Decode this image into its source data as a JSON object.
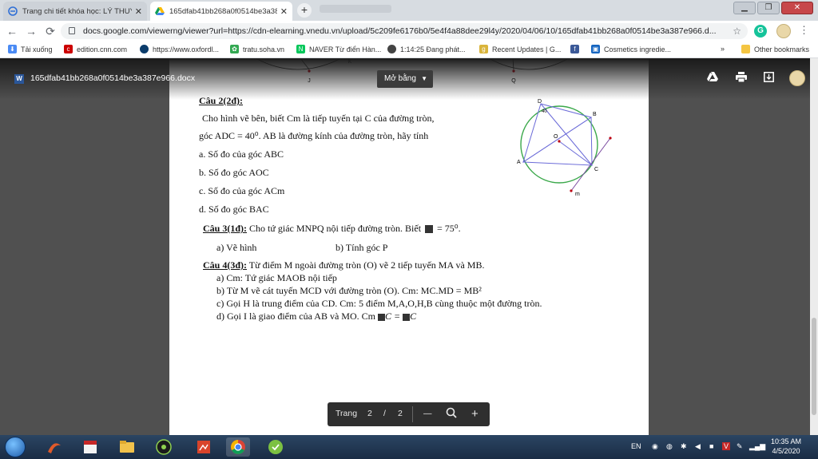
{
  "browser": {
    "tabs": [
      {
        "title": "Trang chi tiết khóa học: LÝ THUY",
        "active": false
      },
      {
        "title": "165dfab41bb268a0f0514be3a38",
        "active": true
      }
    ],
    "new_tab_label": "+",
    "url": "docs.google.com/viewerng/viewer?url=https://cdn-elearning.vnedu.vn/upload/5c209fe6176b0/5e4f4a88dee29l4y/2020/04/06/10/165dfab41bb268a0f0514be3a387e966.d...",
    "bookmarks": [
      {
        "label": "Tải xuống"
      },
      {
        "label": "edition.cnn.com"
      },
      {
        "label": "https://www.oxfordl..."
      },
      {
        "label": "tratu.soha.vn"
      },
      {
        "label": "NAVER Từ điển Hàn..."
      },
      {
        "label": "1:14:25 Đang phát..."
      },
      {
        "label": "Recent Updates | G..."
      },
      {
        "label": "Cosmetics ingredie..."
      }
    ],
    "bookmarks_more": "»",
    "other_bookmarks": "Other bookmarks"
  },
  "viewer": {
    "file_name": "165dfab41bb268a0f0514be3a387e966.docx",
    "open_with_label": "Mở bằng",
    "page_label": "Trang",
    "current_page": "2",
    "page_sep": "/",
    "total_pages": "2",
    "zoom_out": "—",
    "zoom_in": "+"
  },
  "document": {
    "top_labels": {
      "j": "J",
      "q": "Q",
      "k": "K"
    },
    "q2_title": "Câu 2(2đ):",
    "q2_line1": "Cho hình vẽ bên, biết Cm là tiếp tuyến   tại C của đường tròn,",
    "q2_line2": "góc ADC  = 40⁰.  AB là đường kính của đường tròn, hãy tính",
    "q2_a": "a. Số đo của góc ABC",
    "q2_b": "b. Số đo góc AOC",
    "q2_c": "c. Số đo của góc ACm",
    "q2_d": "d. Số đo góc BAC",
    "q3_title": "Câu 3(1đ):",
    "q3_text": " Cho tứ giác MNPQ nội tiếp đường tròn. Biết",
    "q3_value": "= 75⁰.",
    "q3_a": "a)   Vẽ hình",
    "q3_b": "b) Tính góc P",
    "q4_title": "Câu 4(3đ):",
    "q4_text": " Từ điểm M ngoài đường tròn (O) vẽ 2 tiếp tuyến MA và MB.",
    "q4_a": "a)   Cm: Tứ giác MAOB nội tiếp",
    "q4_b": "b)   Từ M vẽ cát tuyến MCD với đường tròn (O). Cm: MC.MD = MB²",
    "q4_c": "c)   Gọi H là trung điểm của CD. Cm: 5 điểm M,A,O,H,B cùng thuộc một đường tròn.",
    "q4_d_pre": "d)   Gọi I là giao điểm của AB và MO. Cm",
    "q4_d_post": "C = ",
    "q4_d_end": "C",
    "figure": {
      "d": "D",
      "b": "B",
      "a": "A",
      "c": "C",
      "o": "O",
      "m": "m",
      "angle": "40"
    }
  },
  "taskbar": {
    "lang": "EN",
    "time": "10:35 AM",
    "date": "4/5/2020"
  }
}
